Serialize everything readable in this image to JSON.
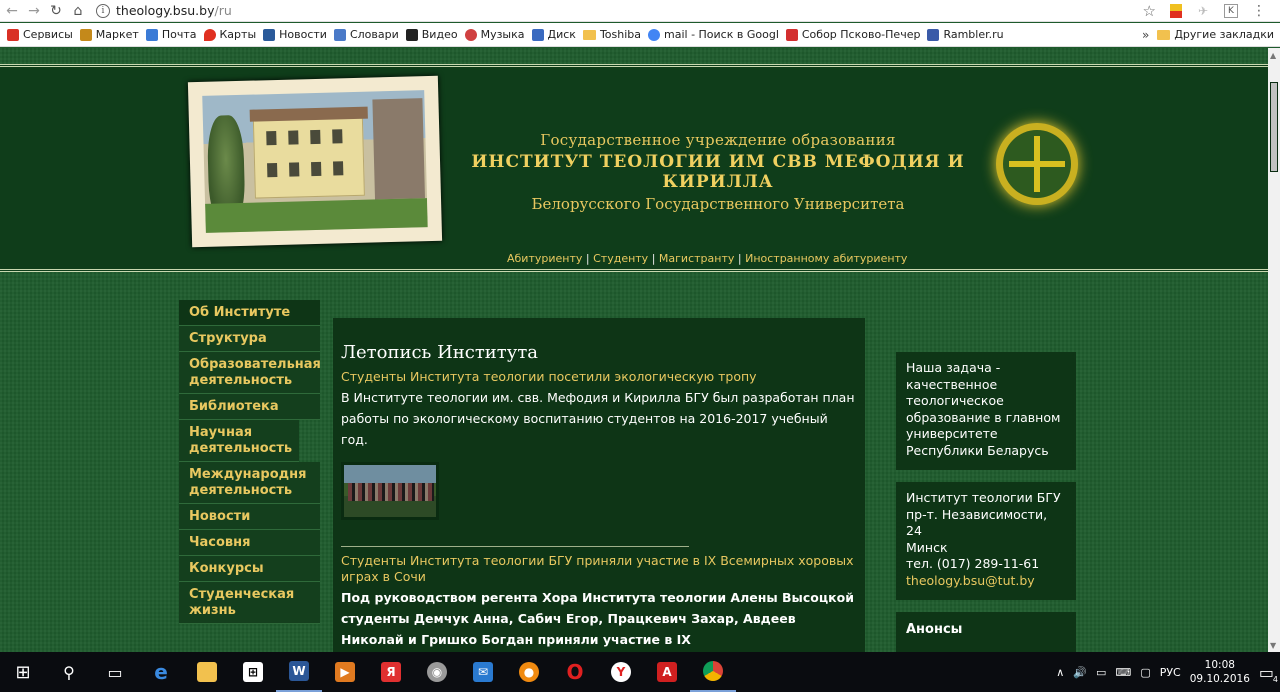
{
  "browser": {
    "url_host": "theology.bsu.by",
    "url_path": "/ru",
    "bookmarks": [
      {
        "label": "Сервисы",
        "color": "#d93025"
      },
      {
        "label": "Маркет",
        "color": "#c4891a"
      },
      {
        "label": "Почта",
        "color": "#3b7bd6"
      },
      {
        "label": "Карты",
        "color": "#e03020"
      },
      {
        "label": "Новости",
        "color": "#2a5a9a"
      },
      {
        "label": "Словари",
        "color": "#4a7ac8"
      },
      {
        "label": "Видео",
        "color": "#222222"
      },
      {
        "label": "Музыка",
        "color": "#d04040"
      },
      {
        "label": "Диск",
        "color": "#3a6ac0"
      },
      {
        "label": "Toshiba",
        "color": "#f2c14e"
      },
      {
        "label": "mail - Поиск в Googl",
        "color": "#4285f4"
      },
      {
        "label": "Собор Псково-Печер",
        "color": "#d32f2f"
      },
      {
        "label": "Rambler.ru",
        "color": "#3a5aa8"
      }
    ],
    "more": "»",
    "other_bookmarks": "Другие закладки"
  },
  "header": {
    "line1": "Государственное учреждение образования",
    "line2": "ИНСТИТУТ ТЕОЛОГИИ ИМ СВВ МЕФОДИЯ И КИРИЛЛА",
    "line3": "Белорусского Государственного Университета",
    "links": [
      "Абитуриенту",
      "Студенту",
      "Магистранту",
      "Иностранному абитуриенту"
    ],
    "sep": "|"
  },
  "sidebar": [
    {
      "label": "Об Институте"
    },
    {
      "label": "Структура"
    },
    {
      "label": "Образовательная деятельность"
    },
    {
      "label": "Библиотека"
    },
    {
      "label": "Научная деятельность"
    },
    {
      "label": "Международня деятельность"
    },
    {
      "label": "Новости"
    },
    {
      "label": "Часовня"
    },
    {
      "label": "Конкурсы"
    },
    {
      "label": "Студенческая жизнь"
    }
  ],
  "main": {
    "heading": "Летопись Института",
    "news1_title": "Студенты Института теологии посетили экологическую тропу",
    "news1_text": "В Институте теологии им. свв. Мефодия и Кирилла БГУ был разработан план работы по экологическому воспитанию студентов на 2016-2017 учебный год.",
    "news2_title": "Студенты Института теологии БГУ приняли участие в IX Всемирных хоровых играх в Сочи",
    "news2_text": "Под руководством регента Хора Института теологии Алены Высоцкой студенты Демчук Анна, Сабич Егор, Працкевич Захар, Авдеев Николай и Гришко Богдан приняли участие в IX"
  },
  "right": {
    "mission": "Наша задача - качественное теологическое образование в главном университете Республики Беларусь",
    "address_name": "Институт теологии БГУ",
    "address_street": "пр-т. Независимости, 24",
    "address_city": "Минск",
    "phone": "тел. (017) 289-11-61",
    "email": "theology.bsu@tut.by",
    "announcements": "Анонсы"
  },
  "taskbar": {
    "lang": "РУС",
    "time": "10:08",
    "date": "09.10.2016",
    "notif_count": "4"
  }
}
